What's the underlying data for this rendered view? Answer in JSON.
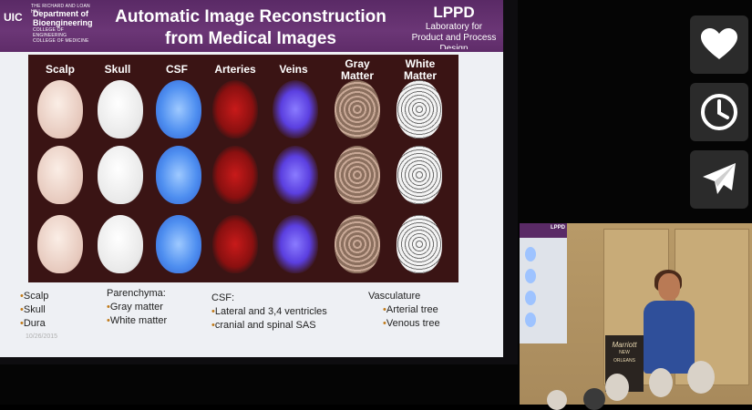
{
  "slide": {
    "title_line1": "Automatic Image Reconstruction",
    "title_line2": "from Medical Images",
    "logo": {
      "top_text": "THE RICHARD AND LOAN HILL",
      "mark": "UIC",
      "dept_line1": "Department of",
      "dept_line2": "Bioengineering",
      "sub_line1": "COLLEGE OF ENGINEERING",
      "sub_line2": "COLLEGE OF MEDICINE"
    },
    "lab": {
      "name": "LPPD",
      "line1": "Laboratory for",
      "line2": "Product and Process",
      "line3": "Design"
    },
    "columns": [
      "Scalp",
      "Skull",
      "CSF",
      "Arteries",
      "Veins",
      "Gray Matter",
      "White Matter"
    ],
    "notes": {
      "group1": [
        "Scalp",
        "Skull",
        "Dura"
      ],
      "group2_title": "Parenchyma:",
      "group2": [
        "Gray matter",
        "White matter"
      ],
      "group3_title": "CSF:",
      "group3": [
        "Lateral and 3,4 ventricles",
        "cranial and spinal SAS"
      ],
      "group4_title": "Vasculature",
      "group4": [
        "Arterial tree",
        "Venous tree"
      ]
    },
    "date": "10/26/2015"
  },
  "mini_slide_label": "LPPD",
  "podium_text": {
    "line1": "Marriott",
    "line2": "NEW ORLEANS"
  },
  "actions": {
    "like_icon": "heart-icon",
    "later_icon": "clock-icon",
    "share_icon": "paper-plane-icon"
  },
  "colors": {
    "header": "#5f2c69",
    "panel": "#3a1414",
    "bullet": "#c07a1a",
    "action_bg": "#2b2b2b"
  }
}
